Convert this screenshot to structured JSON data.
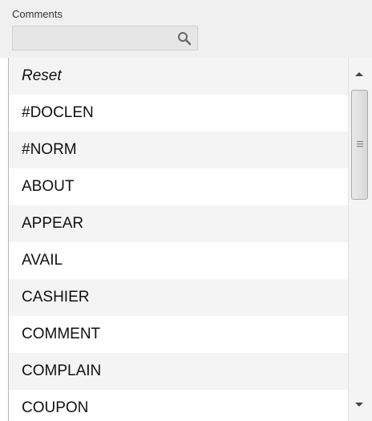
{
  "filter": {
    "label": "Comments",
    "search_value": "",
    "search_placeholder": ""
  },
  "icons": {
    "search": "search-icon",
    "scroll_up": "arrow-up-icon",
    "scroll_down": "arrow-down-icon",
    "scroll_grip": "grip-icon"
  },
  "dropdown": {
    "items": [
      "Reset",
      "#DOCLEN",
      "#NORM",
      "ABOUT",
      "APPEAR",
      "AVAIL",
      "CASHIER",
      "COMMENT",
      "COMPLAIN",
      "COUPON"
    ]
  }
}
